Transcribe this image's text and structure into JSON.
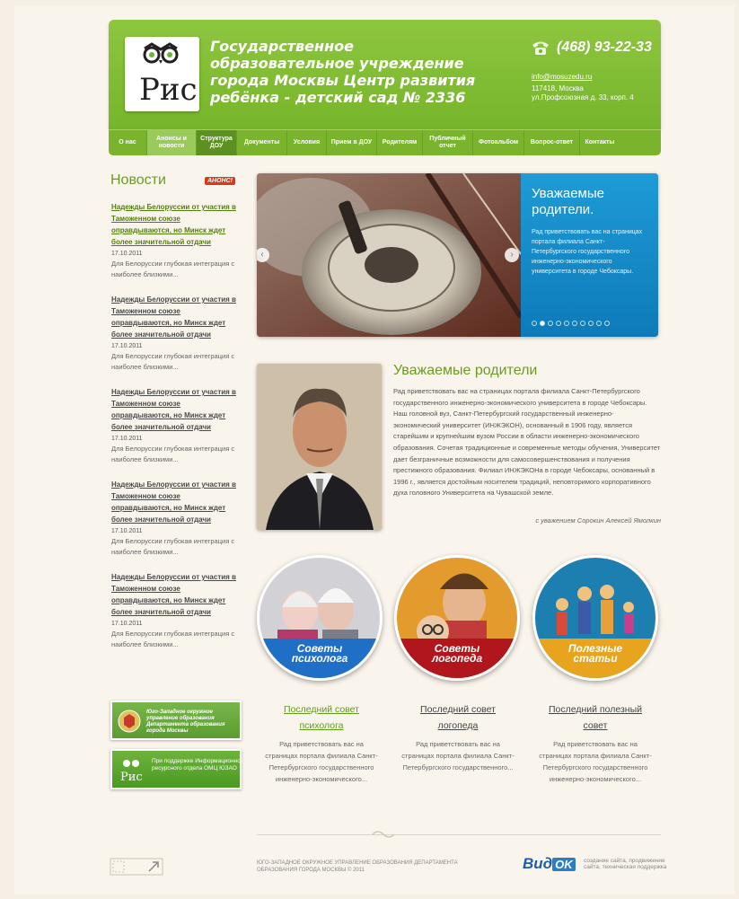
{
  "header": {
    "title": "Государственное образовательное учреждение города Москвы Центр развития ребёнка - детский сад № 2336",
    "phone": "(468) 93-22-33",
    "email": "info@mosuzedu.ru",
    "address_line1": "117418, Москва",
    "address_line2": "ул.Профсоюзная д. 33, корп. 4",
    "logo_text": "Рис"
  },
  "nav": [
    {
      "label": "О нас"
    },
    {
      "label": "Анонсы и новости"
    },
    {
      "label": "Структура ДОУ"
    },
    {
      "label": "Документы"
    },
    {
      "label": "Условия"
    },
    {
      "label": "Прием в ДОУ"
    },
    {
      "label": "Родителям"
    },
    {
      "label": "Публичный отчет"
    },
    {
      "label": "Фотоальбом"
    },
    {
      "label": "Вопрос-ответ"
    },
    {
      "label": "Контакты"
    }
  ],
  "news": {
    "title": "Новости",
    "badge": "АНОНС!",
    "items": [
      {
        "headline": "Надежды Белоруссии от участия в Таможенном союзе оправдываются, но Минск ждет более значительной отдачи",
        "date": "17.10.2011",
        "text": "Для Белоруссии глубокая интеграция с наиболее близкими..."
      },
      {
        "headline": "Надежды Белоруссии от участия в Таможенном союзе оправдываются, но Минск ждет более значительной отдачи",
        "date": "17.10.2011",
        "text": "Для Белоруссии глубокая интеграция с наиболее близкими..."
      },
      {
        "headline": "Надежды Белоруссии от участия в Таможенном союзе оправдываются, но Минск ждет более значительной отдачи",
        "date": "17.10.2011",
        "text": "Для Белоруссии глубокая интеграция с наиболее близкими..."
      },
      {
        "headline": "Надежды Белоруссии от участия в Таможенном союзе оправдываются, но Минск ждет более значительной отдачи",
        "date": "17.10.2011",
        "text": "Для Белоруссии глубокая интеграция с наиболее близкими..."
      },
      {
        "headline": "Надежды Белоруссии от участия в Таможенном союзе оправдываются, но Минск ждет более значительной отдачи",
        "date": "17.10.2011",
        "text": "Для Белоруссии глубокая интеграция с наиболее близкими..."
      }
    ]
  },
  "slider": {
    "title": "Уважаемые родители.",
    "text": "Рад приветствовать вас на страницах портала филиала Санкт-Петербургского государственного инженерно-экономического университета в городе Чебоксары.",
    "dots": 10,
    "active_dot": 2,
    "prev_label": "‹",
    "next_label": "›"
  },
  "director": {
    "title": "Уважаемые родители",
    "text": "Рад приветствовать вас на страницах портала филиала Санкт-Петербургского государственного инженерно-экономического университета в городе Чебоксары. Наш головной вуз, Санкт-Петербургский государственный инженерно-экономический университет (ИНЖЭКОН), основанный в 1906 году, является старейшим и крупнейшим вузом России в области инженерно-экономического образования. Сочетая традиционные и современные методы обучения, Университет дает безграничные возможности для самосовершенствования и получения престижного образования. Филиал ИНЖЭКОНа в городе Чебоксары, основанный в 1996 г., является достойным носителем традиций, неповторимого корпоративного духа головного Университета на Чувашской земле.",
    "signature": "с уважением Сорокин Алексей Ямолкин"
  },
  "circles": [
    {
      "line1": "Советы",
      "line2": "психолога",
      "color": "#1f6fc7"
    },
    {
      "line1": "Советы",
      "line2": "логопеда",
      "color": "#b1161d"
    },
    {
      "line1": "Полезные",
      "line2": "статьи",
      "color": "#e7a41c"
    }
  ],
  "advice": [
    {
      "title": "Последний совет психолога",
      "text": "Рад приветствовать вас на страницах портала филиала Санкт-Петербургского государственного инженерно-экономического..."
    },
    {
      "title": "Последний совет логопеда",
      "text": "Рад приветствовать вас на страницах портала филиала Санкт-Петербургского государственного..."
    },
    {
      "title": "Последний полезный совет",
      "text": "Рад приветствовать вас на страницах портала филиала Санкт-Петербургского государственного инженерно-экономического..."
    }
  ],
  "banners": {
    "first": "Юго-Западное окружное управление образования Департамента образования города Москвы",
    "second": "При поддержке Информационно-ресурсного отдела ОМЦ ЮЗАО",
    "logo_text": "Рис"
  },
  "footer": {
    "org": "ЮГО-ЗАПАДНОЕ ОКРУЖНОЕ УПРАВЛЕНИЕ ОБРАЗОВАНИЯ ДЕПАРТАМЕНТА ОБРАЗОВАНИЯ ГОРОДА МОСКВЫ © 2011",
    "vidok_main": "Вид",
    "vidok_ok": "OK",
    "vidok_text": "создание сайта, продвижение сайта, техническая поддержка"
  },
  "colors": {
    "green": "#7ab52e",
    "title_green": "#6a9c1f",
    "blue": "#1e9bd6",
    "red": "#d73b1e"
  }
}
